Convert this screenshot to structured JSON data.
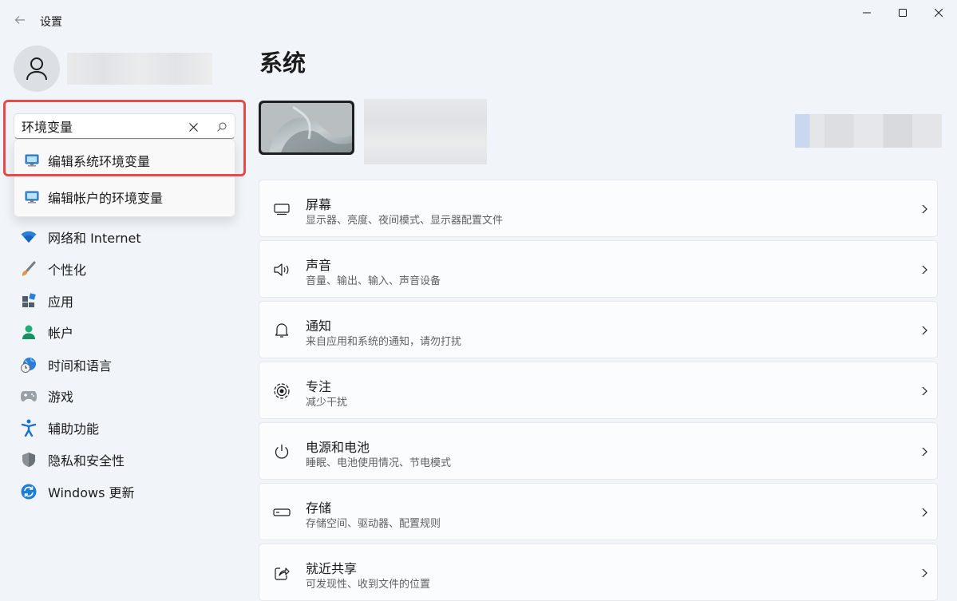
{
  "window": {
    "title": "设置"
  },
  "search": {
    "value": "环境变量",
    "results": [
      {
        "label": "编辑系统环境变量"
      },
      {
        "label": "编辑帐户的环境变量"
      }
    ]
  },
  "sidebar": {
    "items": [
      {
        "label": "网络和 Internet",
        "icon": "wifi-icon"
      },
      {
        "label": "个性化",
        "icon": "brush-icon"
      },
      {
        "label": "应用",
        "icon": "apps-icon"
      },
      {
        "label": "帐户",
        "icon": "person-icon"
      },
      {
        "label": "时间和语言",
        "icon": "globe-clock-icon"
      },
      {
        "label": "游戏",
        "icon": "gamepad-icon"
      },
      {
        "label": "辅助功能",
        "icon": "accessibility-icon"
      },
      {
        "label": "隐私和安全性",
        "icon": "shield-icon"
      },
      {
        "label": "Windows 更新",
        "icon": "update-icon"
      }
    ]
  },
  "main": {
    "title": "系统",
    "cards": [
      {
        "title": "屏幕",
        "subtitle": "显示器、亮度、夜间模式、显示器配置文件",
        "icon": "monitor-icon"
      },
      {
        "title": "声音",
        "subtitle": "音量、输出、输入、声音设备",
        "icon": "speaker-icon"
      },
      {
        "title": "通知",
        "subtitle": "来自应用和系统的通知，请勿打扰",
        "icon": "bell-icon"
      },
      {
        "title": "专注",
        "subtitle": "减少干扰",
        "icon": "focus-icon"
      },
      {
        "title": "电源和电池",
        "subtitle": "睡眠、电池使用情况、节电模式",
        "icon": "power-icon"
      },
      {
        "title": "存储",
        "subtitle": "存储空间、驱动器、配置规则",
        "icon": "storage-icon"
      },
      {
        "title": "就近共享",
        "subtitle": "可发现性、收到文件的位置",
        "icon": "share-icon"
      }
    ]
  },
  "colors": {
    "accent": "#0067c0",
    "highlight": "#e84a4a",
    "background": "#f1f4f9"
  }
}
